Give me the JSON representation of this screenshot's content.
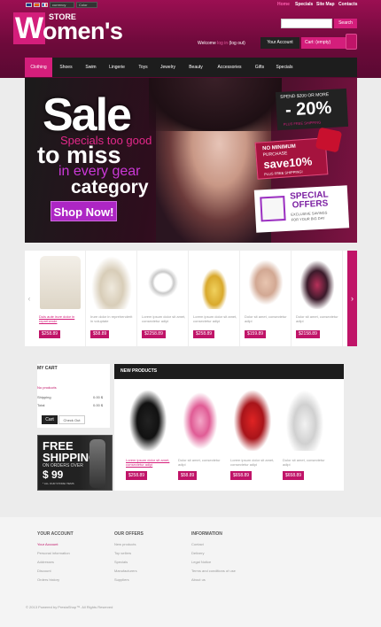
{
  "topbar": {
    "currency": "currency",
    "color": "Color",
    "links": [
      "Home",
      "Specials",
      "Site Map",
      "Contacts"
    ]
  },
  "logo": {
    "letter": "W",
    "store": "STORE",
    "rest": "omen's"
  },
  "search": {
    "placeholder": "",
    "button": "Search"
  },
  "account": {
    "welcome": "Welcome",
    "login": "log in",
    "logout": "log out",
    "your_account": "Your Account",
    "cart": "Cart",
    "cart_state": "(empty)"
  },
  "nav": [
    "Clothing",
    "Shoes",
    "Swim",
    "Lingerie",
    "Toys",
    "Jewelry",
    "Beauty",
    "Accessories",
    "Gifts",
    "Specials"
  ],
  "banner": {
    "sale": "Sale",
    "specials": "Specials too good",
    "to_miss": "to miss",
    "every_gear": "in every gear",
    "category": "category",
    "cta": "Shop Now!",
    "promo1": {
      "line1": "SPEND $200 OR MORE",
      "line2": "- 20%",
      "line3": "PLUS FREE SHIPPING"
    },
    "promo2": {
      "line1": "NO MINIMUM",
      "line2": "PURCHASE",
      "line3": "save10%",
      "line4": "PLUS FREE SHIPPING!"
    },
    "promo3": {
      "line1": "SPECIAL",
      "line2": "OFFERS",
      "line3": "EXCLUSIVE SAVINGS",
      "line4": "FOR YOUR BIG DAY"
    }
  },
  "carousel": [
    {
      "desc": "Duis aute irure dolor in reprehende",
      "price": "$258.89",
      "highlight": true
    },
    {
      "desc": "Irure dolor in reprehenderit in voluptate",
      "price": "$58.89",
      "highlight": false
    },
    {
      "desc": "Lorem ipsum dolor sit amet, consectetur adipi",
      "price": "$2258.89",
      "highlight": false
    },
    {
      "desc": "Lorem ipsum dolor sit amet, consectetur adipi",
      "price": "$258.89",
      "highlight": false
    },
    {
      "desc": "Dolor sit amet, consectetur adipi",
      "price": "$159.89",
      "highlight": false
    },
    {
      "desc": "Dolor sit amet, consectetur adipi",
      "price": "$2158.89",
      "highlight": false
    }
  ],
  "cart": {
    "title": "MY CART",
    "no_products": "No products",
    "shipping_label": "Shipping",
    "shipping_value": "0.00 $",
    "total_label": "Total",
    "total_value": "0.00 $",
    "cart_btn": "Cart",
    "checkout_btn": "Check Out"
  },
  "freeship": {
    "l1": "FREE",
    "l2": "SHIPPING",
    "l3": "ON ORDERS OVER",
    "l4": "$ 99",
    "l5": "* ALL OUR STORE ITEMS"
  },
  "new_products": {
    "title": "NEW PRODUCTS",
    "items": [
      {
        "desc": "Lorem ipsum dolor sit amet, consectetur adipi",
        "price": "$258.89",
        "highlight": true
      },
      {
        "desc": "Dolor sit amet, consectetur adipi",
        "price": "$58.89",
        "highlight": false
      },
      {
        "desc": "Lorem ipsum dolor sit amet, consectetur adipi",
        "price": "$658.89",
        "highlight": false
      },
      {
        "desc": "Dolor sit amet, consectetur adipi",
        "price": "$658.89",
        "highlight": false
      }
    ]
  },
  "footer": {
    "col1": {
      "title": "YOUR ACCOUNT",
      "items": [
        "Your Account",
        "Personal information",
        "Addresses",
        "Discount",
        "Orders history"
      ]
    },
    "col2": {
      "title": "OUR OFFERS",
      "items": [
        "New products",
        "Top sellers",
        "Specials",
        "Manufacturers",
        "Suppliers"
      ]
    },
    "col3": {
      "title": "INFORMATION",
      "items": [
        "Contact",
        "Delivery",
        "Legal Notice",
        "Terms and conditions of use",
        "About us"
      ]
    },
    "copyright": "© 2013 Powered by PrestaShop™. All Rights Reserved"
  },
  "colors": {
    "accent": "#d41e7b",
    "dark": "#1d1d1d",
    "header": "#8a0d4a"
  }
}
